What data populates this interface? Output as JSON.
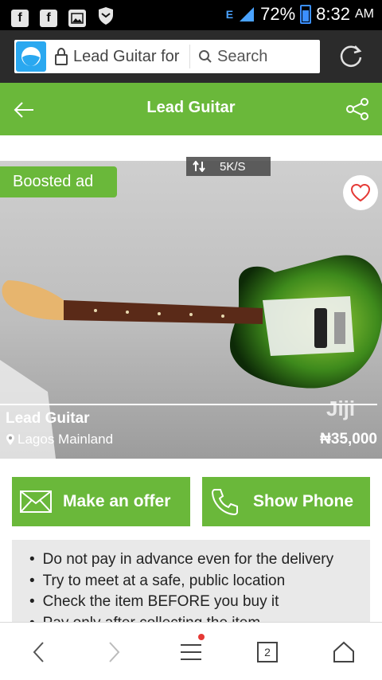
{
  "status_bar": {
    "battery": "72%",
    "time": "8:32",
    "ampm": "AM",
    "network": "E",
    "icons": [
      "facebook-small-icon",
      "facebook-icon",
      "image-icon",
      "shield-icon"
    ]
  },
  "browser": {
    "url_text": "Lead Guitar for",
    "search_label": "Search",
    "tab_count": "2"
  },
  "header": {
    "title": "Lead Guitar"
  },
  "ad": {
    "boosted_label": "Boosted ad",
    "speed": "5K/S",
    "title": "Lead Guitar",
    "location": "Lagos Mainland",
    "price": "₦35,000",
    "watermark": "Jiji"
  },
  "actions": {
    "offer_label": "Make an offer",
    "phone_label": "Show Phone"
  },
  "tips": [
    "Do not pay in advance even for the delivery",
    "Try to meet at a safe, public location",
    "Check the item BEFORE you buy it",
    "Pay only after collecting the item"
  ],
  "colors": {
    "brand_green": "#6ab83a",
    "browser_blue": "#2aa8f0"
  }
}
